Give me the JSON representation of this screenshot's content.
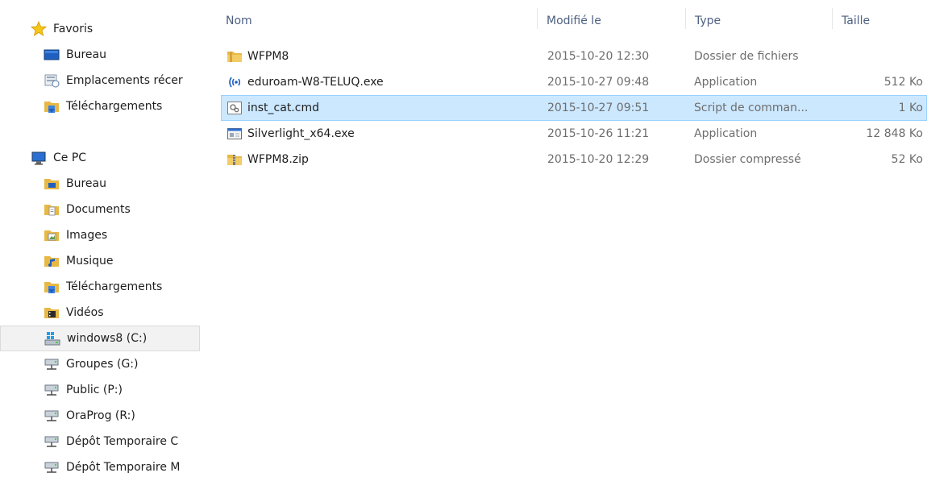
{
  "nav": {
    "favoris": {
      "label": "Favoris",
      "items": [
        {
          "label": "Bureau",
          "icon": "desktop-icon"
        },
        {
          "label": "Emplacements récer",
          "icon": "recent-places-icon"
        },
        {
          "label": "Téléchargements",
          "icon": "downloads-folder-icon"
        }
      ]
    },
    "this_pc": {
      "label": "Ce PC",
      "items": [
        {
          "label": "Bureau",
          "icon": "desktop-folder-icon"
        },
        {
          "label": "Documents",
          "icon": "documents-folder-icon"
        },
        {
          "label": "Images",
          "icon": "images-folder-icon"
        },
        {
          "label": "Musique",
          "icon": "music-folder-icon"
        },
        {
          "label": "Téléchargements",
          "icon": "downloads-folder-icon"
        },
        {
          "label": "Vidéos",
          "icon": "videos-folder-icon"
        },
        {
          "label": "windows8 (C:)",
          "icon": "system-drive-icon",
          "selected": true
        },
        {
          "label": "Groupes (G:)",
          "icon": "network-drive-icon"
        },
        {
          "label": "Public (P:)",
          "icon": "network-drive-icon"
        },
        {
          "label": "OraProg (R:)",
          "icon": "network-drive-icon"
        },
        {
          "label": "Dépôt Temporaire C",
          "icon": "network-drive-icon"
        },
        {
          "label": "Dépôt Temporaire M",
          "icon": "network-drive-icon"
        }
      ]
    }
  },
  "columns": {
    "name": "Nom",
    "modified": "Modifié le",
    "type": "Type",
    "size": "Taille"
  },
  "files": [
    {
      "name": "WFPM8",
      "modified": "2015-10-20 12:30",
      "type": "Dossier de fichiers",
      "size": "",
      "icon": "folder-icon"
    },
    {
      "name": "eduroam-W8-TELUQ.exe",
      "modified": "2015-10-27 09:48",
      "type": "Application",
      "size": "512 Ko",
      "icon": "wireless-app-icon"
    },
    {
      "name": "inst_cat.cmd",
      "modified": "2015-10-27 09:51",
      "type": "Script de comman...",
      "size": "1 Ko",
      "icon": "script-file-icon",
      "selected": true
    },
    {
      "name": "Silverlight_x64.exe",
      "modified": "2015-10-26 11:21",
      "type": "Application",
      "size": "12 848 Ko",
      "icon": "application-icon"
    },
    {
      "name": "WFPM8.zip",
      "modified": "2015-10-20 12:29",
      "type": "Dossier compressé",
      "size": "52 Ko",
      "icon": "zip-folder-icon"
    }
  ],
  "colors": {
    "selection_bg": "#cce8ff",
    "selection_border": "#99d1ff",
    "header_text": "#4d6082",
    "folder_yellow": "#e8b845"
  }
}
